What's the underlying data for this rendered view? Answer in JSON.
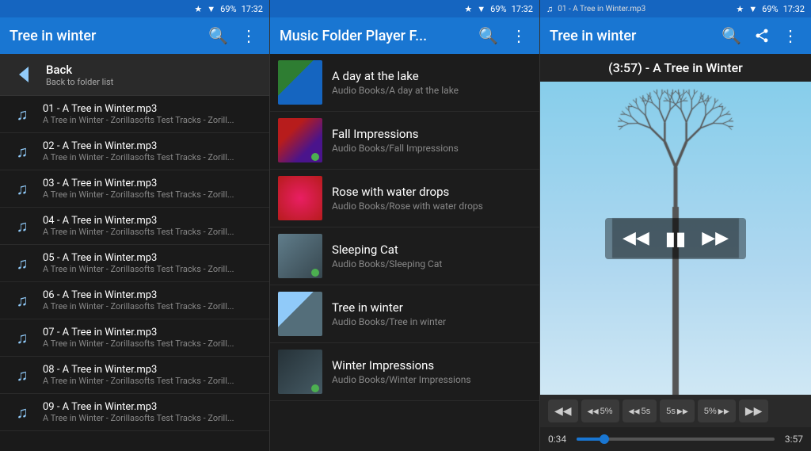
{
  "panel1": {
    "status": {
      "battery": "69%",
      "time": "17:32"
    },
    "appbar": {
      "title": "Tree in winter",
      "search_label": "Search",
      "menu_label": "More options"
    },
    "back": {
      "title": "Back",
      "subtitle": "Back to folder list"
    },
    "files": [
      {
        "name": "01 - A Tree in Winter.mp3",
        "sub": "A Tree in Winter - Zorillasofts Test Tracks - Zorill..."
      },
      {
        "name": "02 - A Tree in Winter.mp3",
        "sub": "A Tree in Winter - Zorillasofts Test Tracks - Zorill..."
      },
      {
        "name": "03 - A Tree in Winter.mp3",
        "sub": "A Tree in Winter - Zorillasofts Test Tracks - Zorill..."
      },
      {
        "name": "04 - A Tree in Winter.mp3",
        "sub": "A Tree in Winter - Zorillasofts Test Tracks - Zorill..."
      },
      {
        "name": "05 - A Tree in Winter.mp3",
        "sub": "A Tree in Winter - Zorillasofts Test Tracks - Zorill..."
      },
      {
        "name": "06 - A Tree in Winter.mp3",
        "sub": "A Tree in Winter - Zorillasofts Test Tracks - Zorill..."
      },
      {
        "name": "07 - A Tree in Winter.mp3",
        "sub": "A Tree in Winter - Zorillasofts Test Tracks - Zorill..."
      },
      {
        "name": "08 - A Tree in Winter.mp3",
        "sub": "A Tree in Winter - Zorillasofts Test Tracks - Zorill..."
      },
      {
        "name": "09 - A Tree in Winter.mp3",
        "sub": "A Tree in Winter - Zorillasofts Test Tracks - Zorill..."
      }
    ]
  },
  "panel2": {
    "status": {
      "battery": "69%",
      "time": "17:32"
    },
    "appbar": {
      "title": "Music Folder Player F...",
      "search_label": "Search",
      "menu_label": "More options"
    },
    "folders": [
      {
        "name": "A day at the lake",
        "path": "Audio Books/A day at the lake",
        "playing": false,
        "thumb_class": "thumb-lake"
      },
      {
        "name": "Fall Impressions",
        "path": "Audio Books/Fall Impressions",
        "playing": true,
        "thumb_class": "thumb-fall"
      },
      {
        "name": "Rose with water drops",
        "path": "Audio Books/Rose with water drops",
        "playing": false,
        "thumb_class": "thumb-rose"
      },
      {
        "name": "Sleeping Cat",
        "path": "Audio Books/Sleeping Cat",
        "playing": true,
        "thumb_class": "thumb-cat"
      },
      {
        "name": "Tree in winter",
        "path": "Audio Books/Tree in winter",
        "playing": false,
        "thumb_class": "thumb-winter"
      },
      {
        "name": "Winter Impressions",
        "path": "Audio Books/Winter Impressions",
        "playing": true,
        "thumb_class": "thumb-impressions"
      }
    ]
  },
  "panel3": {
    "status": {
      "notification": "01 - A Tree in Winter.mp3",
      "battery": "69%",
      "time": "17:32"
    },
    "appbar": {
      "title": "Tree in winter",
      "search_label": "Search",
      "share_label": "Share",
      "menu_label": "More options"
    },
    "player": {
      "title": "(3:57) - A Tree in Winter",
      "current_time": "0:34",
      "total_time": "3:57",
      "progress_pct": 14
    },
    "controls": [
      {
        "id": "rewind-all",
        "icon": "⏮",
        "label": "Rewind all"
      },
      {
        "id": "rewind-5pct",
        "icon": "◀◀",
        "label": "5%",
        "value": "5%"
      },
      {
        "id": "rewind-5s",
        "icon": "◀◀",
        "label": "5s",
        "value": "5s"
      },
      {
        "id": "forward-5s",
        "icon": "▶▶",
        "label": "5s",
        "value": "5s"
      },
      {
        "id": "forward-5pct",
        "icon": "▶▶",
        "label": "5%",
        "value": "5%"
      },
      {
        "id": "forward-all",
        "icon": "⏭",
        "label": "Forward all"
      }
    ]
  }
}
